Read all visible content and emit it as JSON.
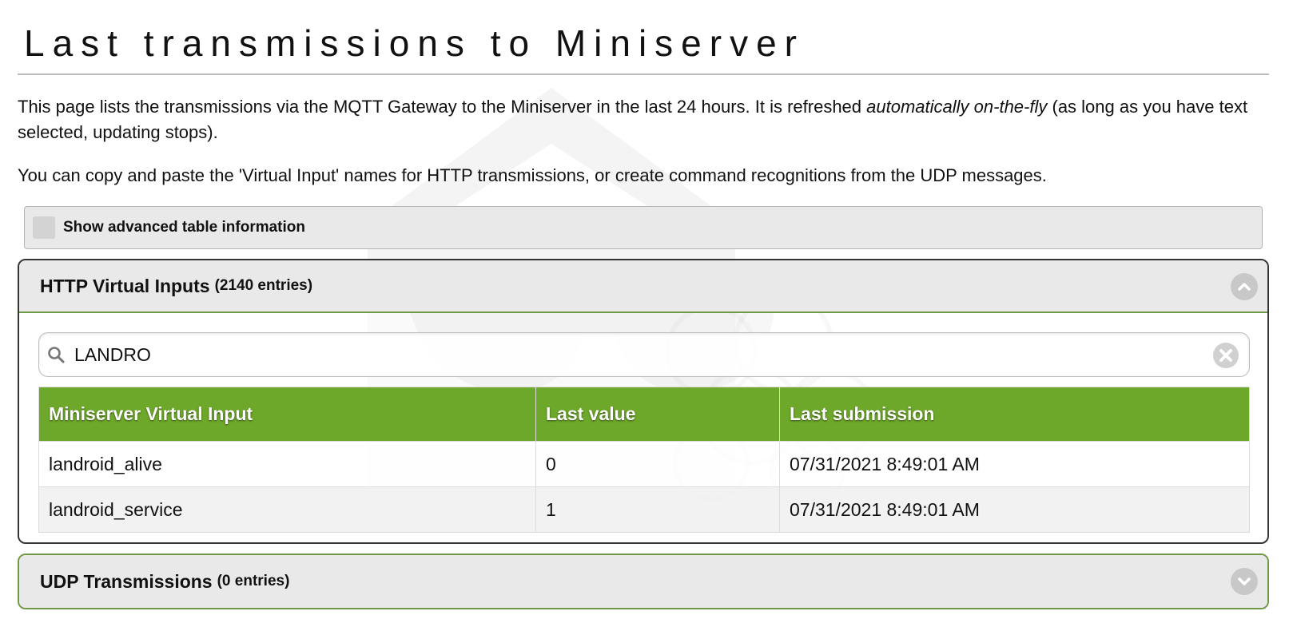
{
  "page": {
    "title": "Last transmissions to Miniserver",
    "intro": {
      "before": "This page lists the transmissions via the MQTT Gateway to the Miniserver in the last 24 hours. It is refreshed ",
      "emphasis": "automatically on-the-fly",
      "after": " (as long as you have text selected, updating stops)."
    },
    "intro2": "You can copy and paste the 'Virtual Input' names for HTTP transmissions, or create command recognitions from the UDP messages."
  },
  "advanced": {
    "label": "Show advanced table information",
    "checked": false
  },
  "http_section": {
    "title": "HTTP Virtual Inputs",
    "count": "(2140 entries)",
    "expanded": true,
    "search": {
      "value": "LANDRO",
      "placeholder": ""
    },
    "table": {
      "headers": [
        "Miniserver Virtual Input",
        "Last value",
        "Last submission"
      ],
      "rows": [
        [
          "landroid_alive",
          "0",
          "07/31/2021 8:49:01 AM"
        ],
        [
          "landroid_service",
          "1",
          "07/31/2021 8:49:01 AM"
        ]
      ]
    }
  },
  "udp_section": {
    "title": "UDP Transmissions",
    "count": "(0 entries)",
    "expanded": false
  },
  "colors": {
    "accent_green": "#6ea82a",
    "border_green": "#6f9a45",
    "header_gray": "#e9e9e9"
  },
  "icons": {
    "search": "magnifier-icon",
    "clear": "clear-x-icon",
    "collapse": "chevron-up-icon",
    "expand": "chevron-down-icon"
  }
}
